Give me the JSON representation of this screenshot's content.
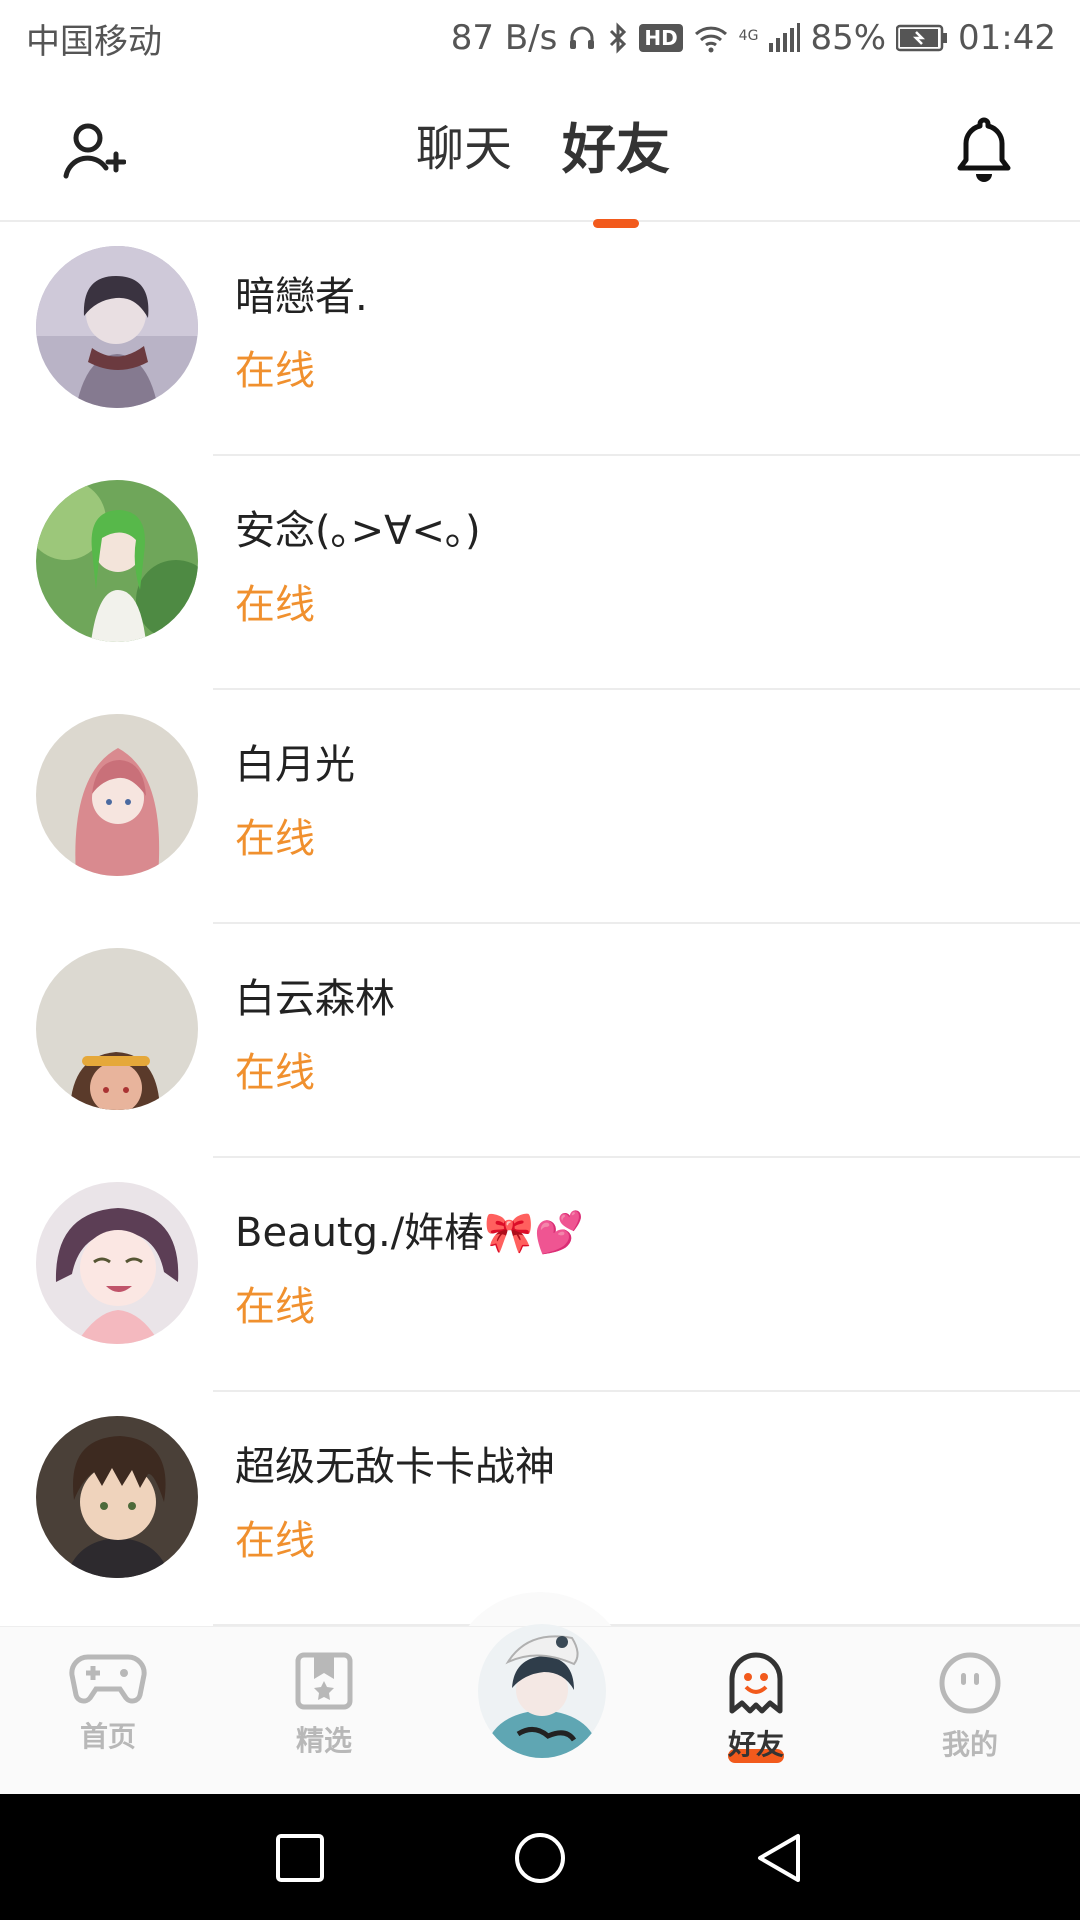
{
  "status_bar": {
    "carrier": "中国移动",
    "net_speed": "87 B/s",
    "hd_badge": "HD",
    "signal_label": "4G",
    "battery": "85%",
    "time": "01:42"
  },
  "header": {
    "tabs": [
      {
        "label": "聊天",
        "active": false
      },
      {
        "label": "好友",
        "active": true
      }
    ],
    "accent_color": "#f25a1c"
  },
  "friends": [
    {
      "name": "暗戀者.",
      "status": "在线"
    },
    {
      "name": "安念(｡>∀<｡)",
      "status": "在线"
    },
    {
      "name": "白月光",
      "status": "在线"
    },
    {
      "name": "白云森林",
      "status": "在线"
    },
    {
      "name": "Beautg./姩椿🎀💕",
      "status": "在线"
    },
    {
      "name": "超级无敌卡卡战神",
      "status": "在线"
    }
  ],
  "status_color": "#f0902e",
  "bottom_nav": {
    "items": [
      {
        "label": "首页",
        "icon": "gamepad-icon"
      },
      {
        "label": "精选",
        "icon": "star-bookmark-icon"
      },
      {
        "label": "好友",
        "icon": "ghost-icon",
        "active": true
      },
      {
        "label": "我的",
        "icon": "smiley-icon"
      }
    ]
  }
}
